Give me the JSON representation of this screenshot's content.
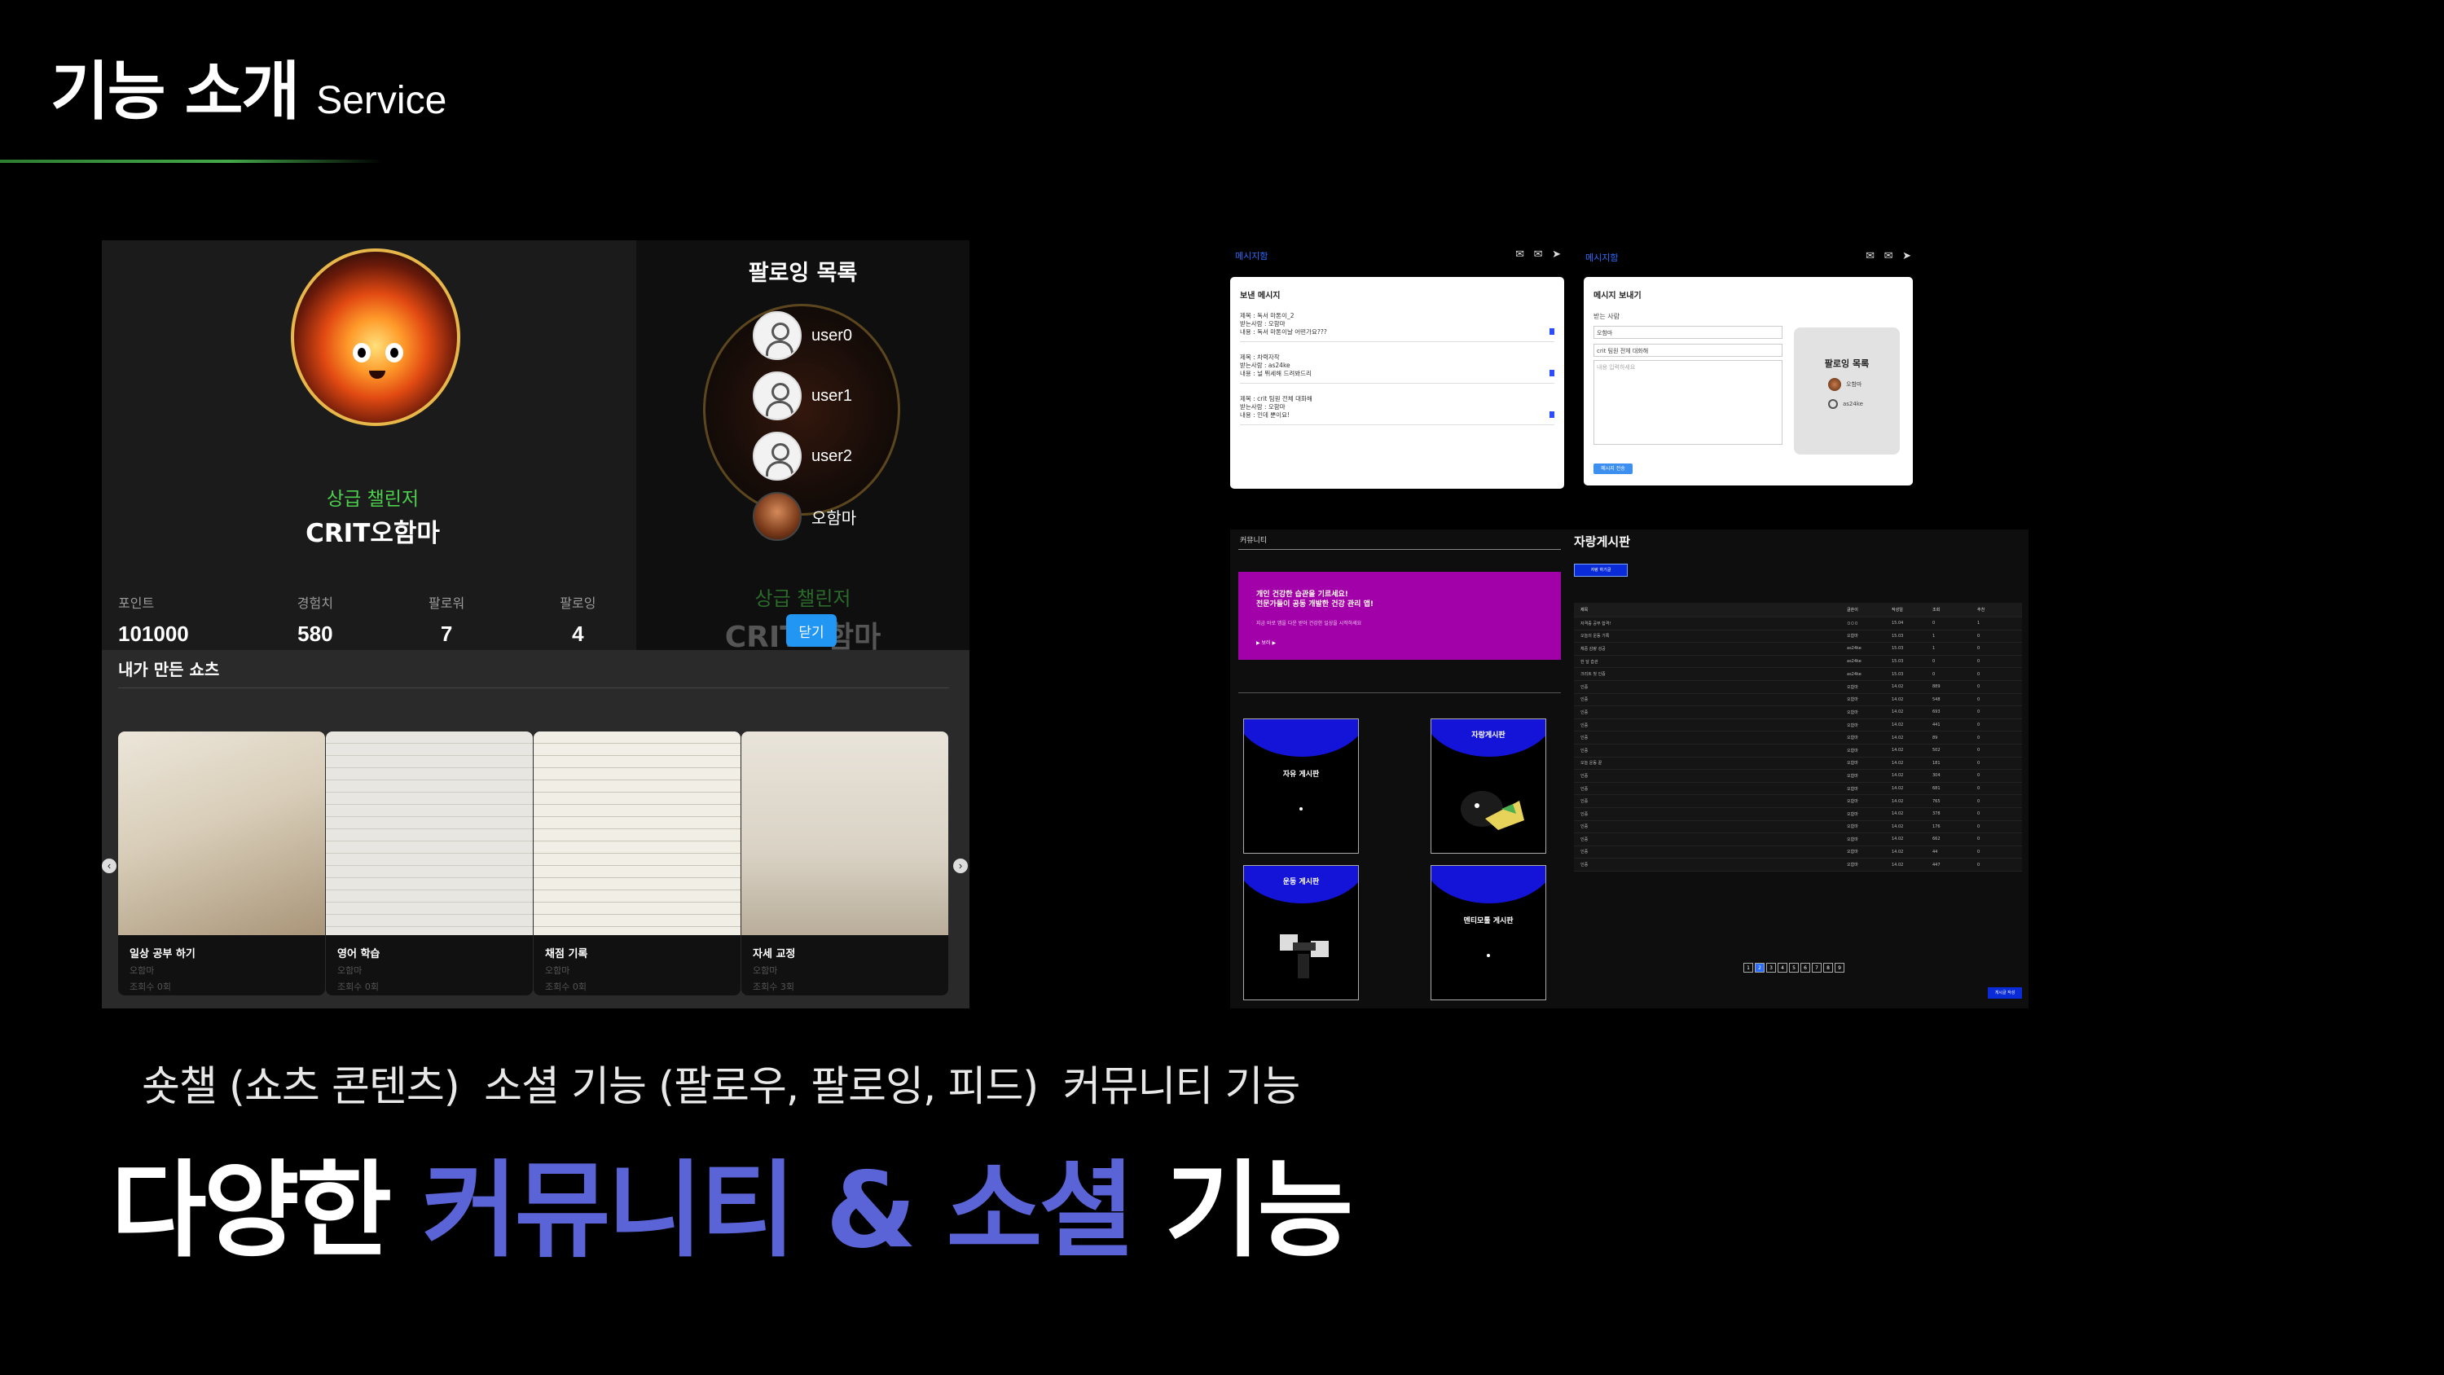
{
  "header": {
    "title_kr": "기능 소개",
    "title_en": "Service"
  },
  "profile": {
    "rank": "상급 챌린저",
    "nickname": "CRIT오함마",
    "stats": [
      {
        "label": "포인트",
        "value": "101000"
      },
      {
        "label": "경험치",
        "value": "580"
      },
      {
        "label": "팔로워",
        "value": "7"
      },
      {
        "label": "팔로잉",
        "value": "4"
      }
    ]
  },
  "following_modal": {
    "title": "팔로잉 목록",
    "users": [
      "user0",
      "user1",
      "user2",
      "오함마"
    ],
    "ghost_rank": "상급 챌린저",
    "ghost_nick": "CRIT오함마",
    "close_label": "닫기"
  },
  "shorts": {
    "title": "내가 만든 쇼츠",
    "cards": [
      {
        "title": "일상 공부 하기",
        "author": "오함마",
        "views": "조회수 0회"
      },
      {
        "title": "영어 학습",
        "author": "오함마",
        "views": "조회수 0회"
      },
      {
        "title": "채점 기록",
        "author": "오함마",
        "views": "조회수 0회"
      },
      {
        "title": "자세 교정",
        "author": "오함마",
        "views": "조회수 3회"
      }
    ],
    "prev_icon": "chevron-left-icon",
    "next_icon": "chevron-right-icon"
  },
  "messages": {
    "brand": "메시지함",
    "icons": "✉ ✉ ➤",
    "sent": {
      "title": "보낸 메시지",
      "items": [
        {
          "subject": "제목 : 독서 마톤이_2",
          "to": "받는사람 : 오함마",
          "content": "내용 : 독서 마톤이날 어떤가요???"
        },
        {
          "subject": "제목 : 차력자작",
          "to": "받는사람 : as24ke",
          "content": "내용 : 널 뛰세해 드려봐드리"
        },
        {
          "subject": "제목 : crit 팀원 전체 대화해",
          "to": "받는사람 : 오함마",
          "content": "내용 : 인데 뿐이요!"
        }
      ]
    },
    "compose": {
      "title": "메시지 보내기",
      "to_label": "받는 사람",
      "to_value": "오함마",
      "subject_value": "crit 팀원 전체 대화해",
      "body_placeholder": "내용 입력하세요",
      "send_label": "메시지 전송",
      "following_title": "팔로잉 목록",
      "following": [
        "오함마",
        "as24ke"
      ]
    }
  },
  "community": {
    "header": "커뮤니티",
    "banner_line1": "개인 건강한 습관을 기르세요!",
    "banner_line2": "전문가들이 공동 개발한 건강 관리 앱!",
    "banner_sub": "지금 바로 앱을 다운 받아 건강한 일상을 시작하세요",
    "banner_more": "▶ 보러 ▶",
    "boards": [
      "자유 게시판",
      "자랑게시판",
      "운동 게시판",
      "멘티모툴 게시판"
    ],
    "brag_title": "자랑게시판",
    "brag_button": "자랑 하기글",
    "table_head": [
      "제목",
      "글쓴이",
      "작성일",
      "조회",
      "추천"
    ],
    "rows": [
      [
        "자격증 공부 합격!",
        "ㅁㅁㅁ",
        "15.04",
        "0",
        "1"
      ],
      [
        "오늘의 운동 기록",
        "오함마",
        "15.03",
        "1",
        "0"
      ],
      [
        "체중 감량 성공",
        "as24ke",
        "15.03",
        "1",
        "0"
      ],
      [
        "한 달 습관",
        "as24ke",
        "15.03",
        "0",
        "0"
      ],
      [
        "크리트 첫 인증",
        "as24ke",
        "15.03",
        "0",
        "0"
      ],
      [
        "인증",
        "오함마",
        "14.02",
        "889",
        "0"
      ],
      [
        "인증",
        "오함마",
        "14.02",
        "548",
        "0"
      ],
      [
        "인증",
        "오함마",
        "14.02",
        "693",
        "0"
      ],
      [
        "인증",
        "오함마",
        "14.02",
        "441",
        "0"
      ],
      [
        "인증",
        "오함마",
        "14.02",
        "89",
        "0"
      ],
      [
        "인증",
        "오함마",
        "14.02",
        "502",
        "0"
      ],
      [
        "오늘 운동 끝",
        "오함마",
        "14.02",
        "181",
        "0"
      ],
      [
        "인증",
        "오함마",
        "14.02",
        "304",
        "0"
      ],
      [
        "인증",
        "오함마",
        "14.02",
        "681",
        "0"
      ],
      [
        "인증",
        "오함마",
        "14.02",
        "765",
        "0"
      ],
      [
        "인증",
        "오함마",
        "14.02",
        "378",
        "0"
      ],
      [
        "인증",
        "오함마",
        "14.02",
        "176",
        "0"
      ],
      [
        "인증",
        "오함마",
        "14.02",
        "662",
        "0"
      ],
      [
        "인증",
        "오함마",
        "14.02",
        "44",
        "0"
      ],
      [
        "인증",
        "오함마",
        "14.02",
        "447",
        "0"
      ]
    ],
    "pages": [
      "1",
      "2",
      "3",
      "4",
      "5",
      "6",
      "7",
      "8",
      "9"
    ],
    "active_page": 2,
    "write_label": "게시글 작성"
  },
  "features_line": "숏챌 (쇼츠 콘텐츠)  소셜 기능 (팔로우, 팔로잉, 피드)  커뮤니티 기능",
  "headline": {
    "part1": "다양한 ",
    "accent": "커뮤니티 & 소셜",
    "part2": " 기능"
  },
  "colors": {
    "accent": "#5a64d6",
    "rank_green": "#4ccf4c",
    "banner": "#a200a8",
    "board_cap": "#1414d8"
  }
}
